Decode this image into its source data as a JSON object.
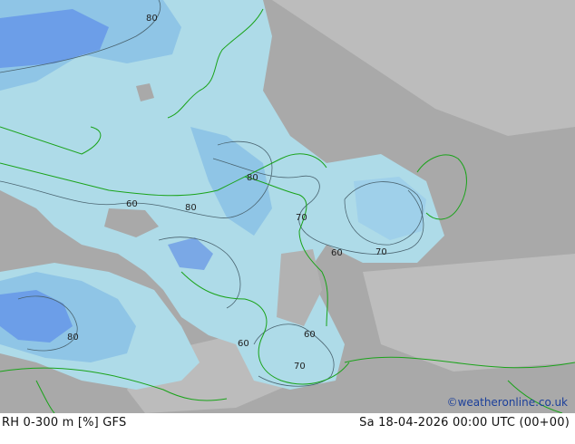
{
  "map": {
    "colors": {
      "gray_dark": "#a8a8a8",
      "gray_light": "#bdbdbd",
      "blue_light": "#aedbe8",
      "blue_mid": "#8fc5e6",
      "blue_deep": "#6c9ee8",
      "coast": "#1aa31a",
      "contour": "#4a6470"
    },
    "contour_labels": [
      "80",
      "60",
      "80",
      "80",
      "70",
      "60",
      "70",
      "80",
      "60",
      "60",
      "70"
    ]
  },
  "footer": {
    "left": "RH 0-300 m [%] GFS",
    "right": "Sa 18-04-2026 00:00 UTC (00+00)",
    "copyright": "©weatheronline.co.uk"
  }
}
